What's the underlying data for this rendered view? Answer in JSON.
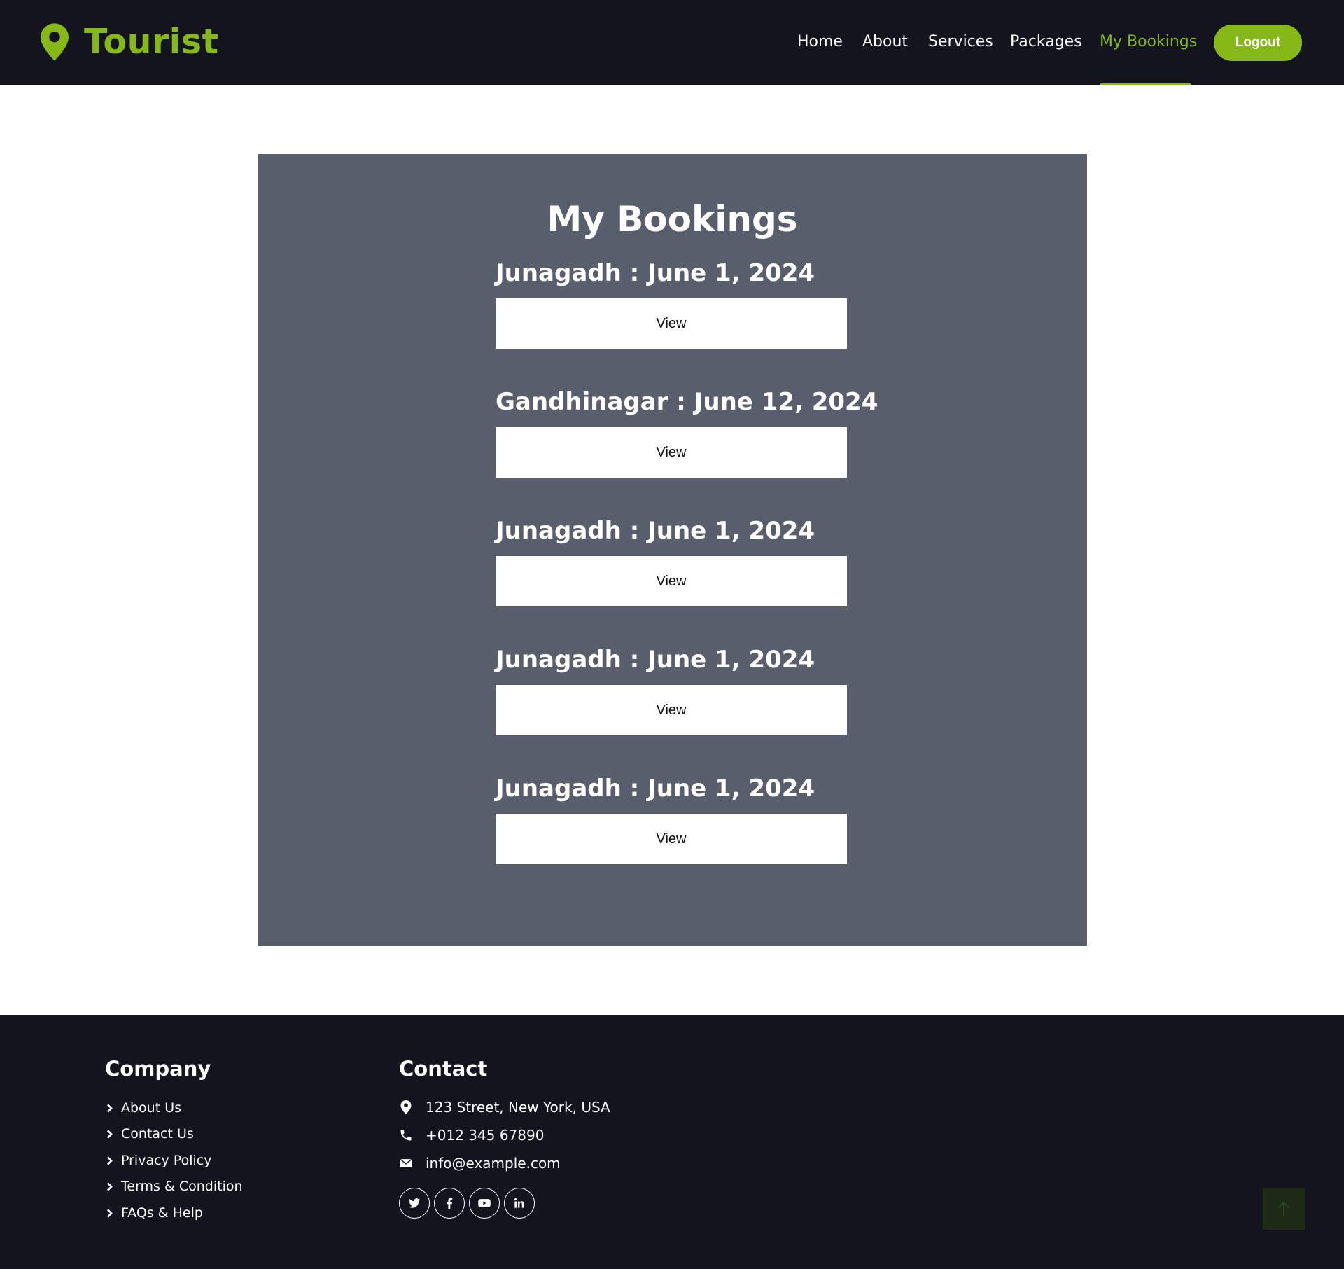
{
  "header": {
    "brand": "Tourist",
    "nav": [
      "Home",
      "About",
      "Services",
      "Packages",
      "My Bookings"
    ],
    "active_nav": "My Bookings",
    "logout_label": "Logout",
    "accent_color": "#86b817",
    "background_color": "#14141f"
  },
  "main": {
    "title": "My Bookings",
    "card_color": "#585e6c",
    "bookings": [
      {
        "label": "Junagadh : June 1, 2024",
        "button": "View"
      },
      {
        "label": "Gandhinagar : June 12, 2024",
        "button": "View"
      },
      {
        "label": "Junagadh : June 1, 2024",
        "button": "View"
      },
      {
        "label": "Junagadh : June 1, 2024",
        "button": "View"
      },
      {
        "label": "Junagadh : June 1, 2024",
        "button": "View"
      }
    ]
  },
  "footer": {
    "company_heading": "Company",
    "company_links": [
      "About Us",
      "Contact Us",
      "Privacy Policy",
      "Terms & Condition",
      "FAQs & Help"
    ],
    "contact_heading": "Contact",
    "address": "123 Street, New York, USA",
    "phone": "+012 345 67890",
    "email": "info@example.com",
    "socials": [
      "twitter-icon",
      "facebook-icon",
      "youtube-icon",
      "linkedin-icon"
    ],
    "back_to_top_icon": "arrow-up-icon"
  }
}
